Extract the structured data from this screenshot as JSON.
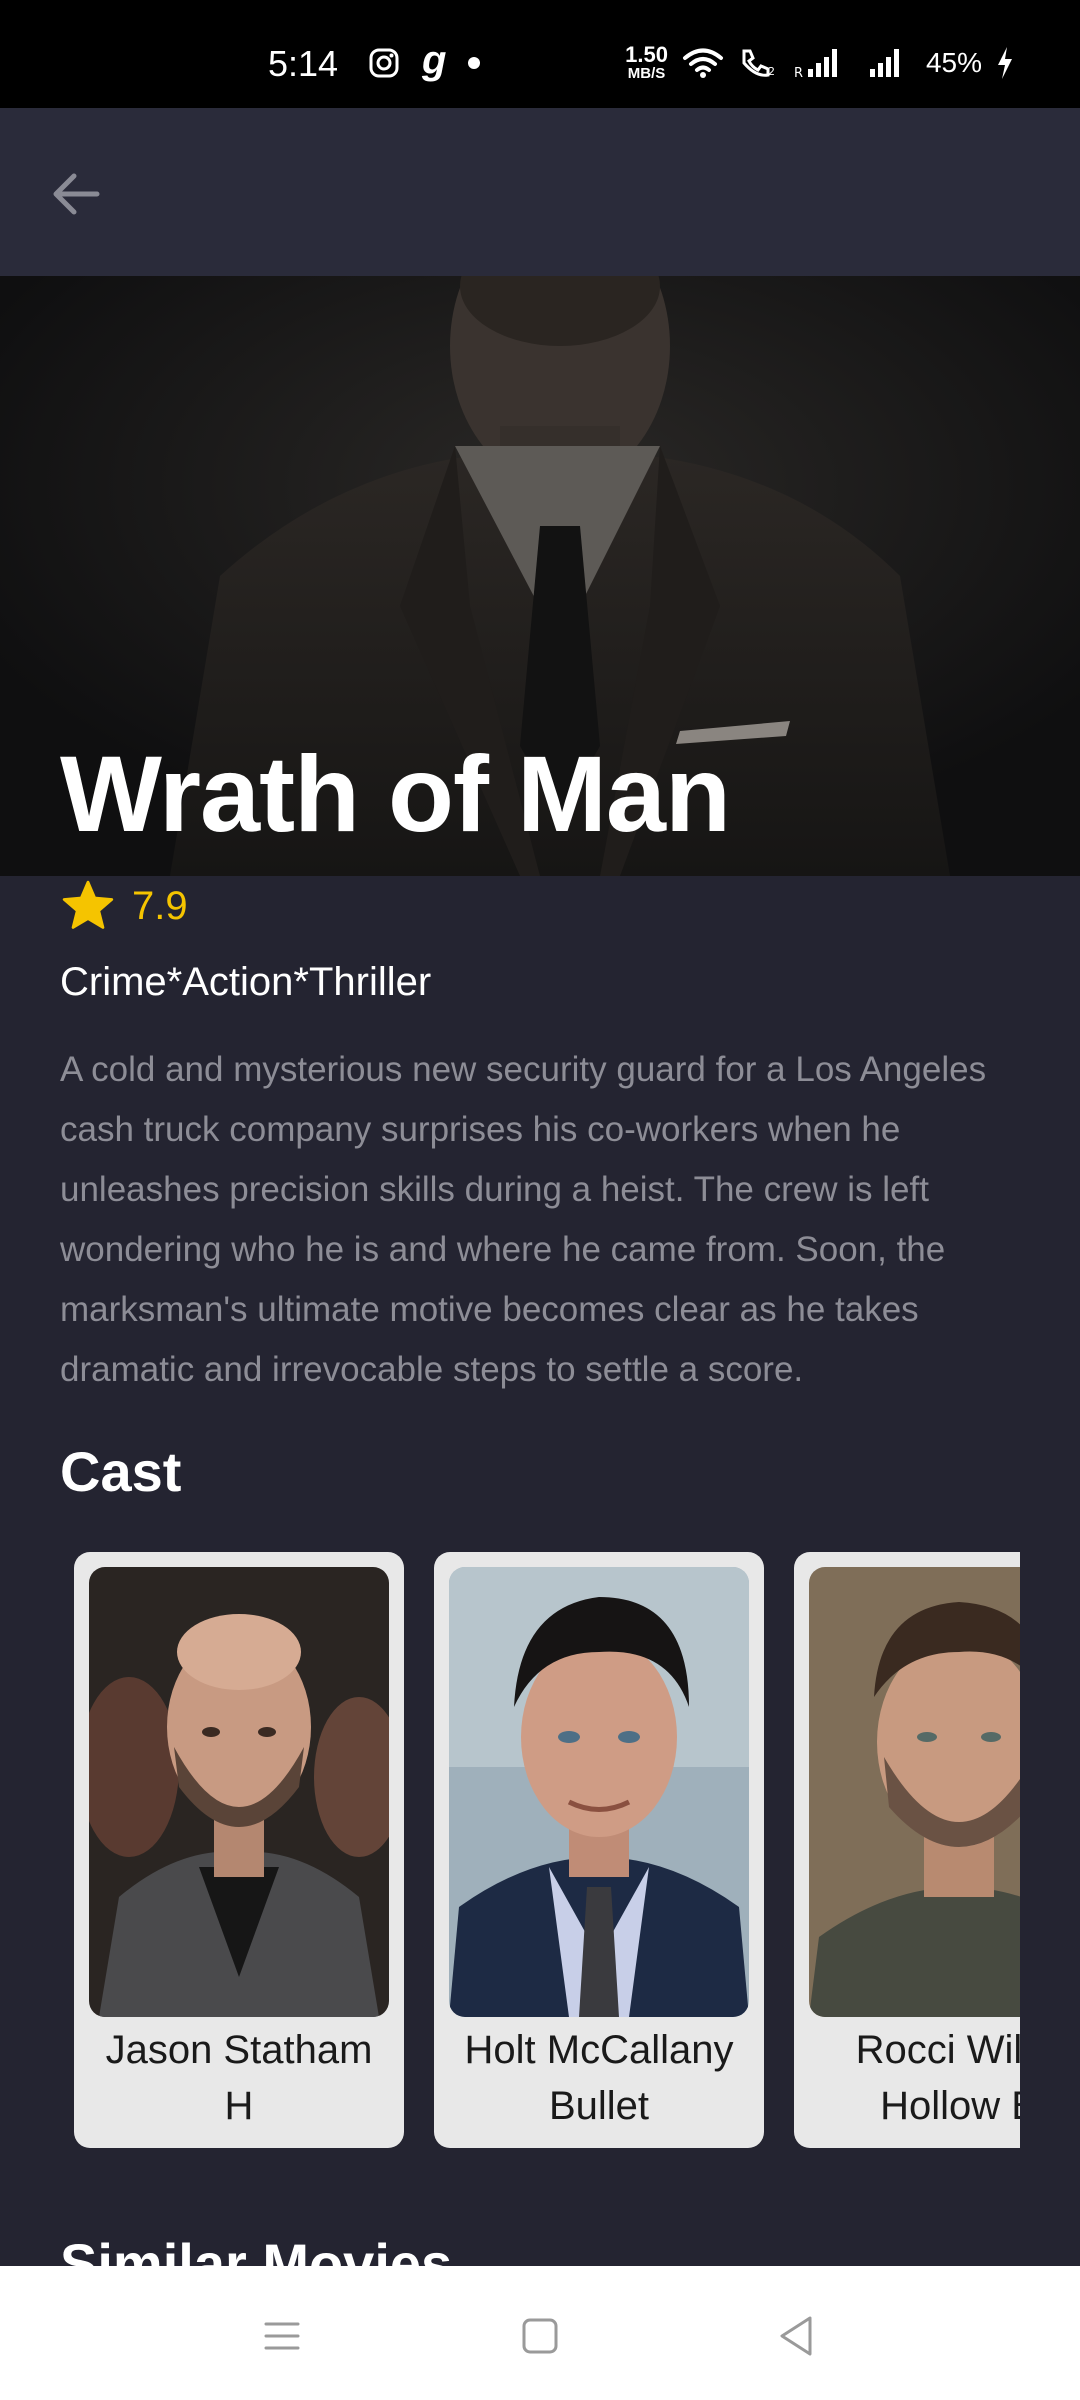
{
  "status_bar": {
    "time": "5:14",
    "net_speed_value": "1.50",
    "net_speed_unit": "MB/S",
    "battery": "45%",
    "icons": [
      "instagram-icon",
      "g-app-icon",
      "dot-icon",
      "wifi-icon",
      "wifi-calling-icon",
      "signal-icon",
      "battery-charging-icon"
    ]
  },
  "app_bar": {
    "back_icon": "arrow-back-icon"
  },
  "movie": {
    "title": "Wrath of Man",
    "rating": "7.9",
    "genres": "Crime*Action*Thriller",
    "overview": "A cold and mysterious new security guard for a Los Angeles cash truck company surprises his co-workers when he unleashes precision skills during a heist. The crew is left wondering who he is and where he came from. Soon, the marksman's ultimate motive becomes clear as he takes dramatic and irrevocable steps to settle a score."
  },
  "colors": {
    "background": "#242431",
    "app_bar": "#2a2b3a",
    "rating": "#f5c400",
    "overview_text": "#8d8d96",
    "card": "#e8e8e8"
  },
  "cast": {
    "title": "Cast",
    "members": [
      {
        "name": "Jason Statham",
        "role": "H"
      },
      {
        "name": "Holt McCallany",
        "role": "Bullet"
      },
      {
        "name": "Rocci Willia",
        "role": "Hollow B"
      }
    ]
  },
  "similar": {
    "title": "Similar Movies"
  },
  "nav_bar": {
    "icons": [
      "recent-apps-icon",
      "home-icon",
      "back-triangle-icon"
    ]
  }
}
